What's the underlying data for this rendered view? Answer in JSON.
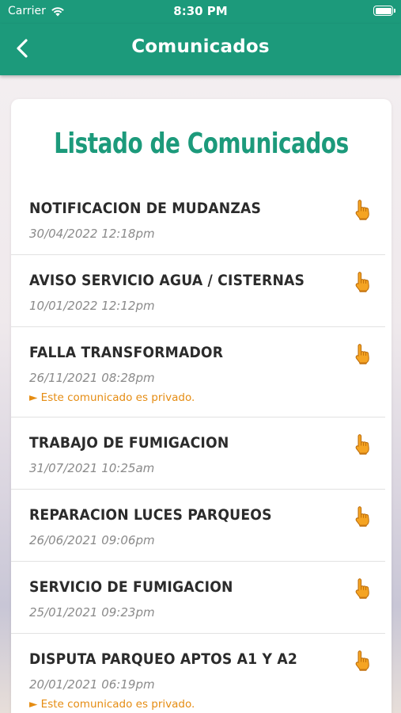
{
  "status": {
    "carrier": "Carrier",
    "time": "8:30 PM"
  },
  "nav": {
    "title": "Comunicados",
    "back_icon": "chevron-left-icon"
  },
  "list": {
    "heading": "Listado de Comunicados",
    "items": [
      {
        "title": "NOTIFICACION DE MUDANZAS",
        "date": "30/04/2022 12:18pm",
        "private": ""
      },
      {
        "title": "AVISO SERVICIO AGUA / CISTERNAS",
        "date": "10/01/2022 12:12pm",
        "private": ""
      },
      {
        "title": "FALLA TRANSFORMADOR",
        "date": "26/11/2021 08:28pm",
        "private": "► Este comunicado es privado."
      },
      {
        "title": "TRABAJO DE FUMIGACION",
        "date": "31/07/2021 10:25am",
        "private": ""
      },
      {
        "title": "REPARACION LUCES PARQUEOS",
        "date": "26/06/2021 09:06pm",
        "private": ""
      },
      {
        "title": "SERVICIO DE FUMIGACION",
        "date": "25/01/2021 09:23pm",
        "private": ""
      },
      {
        "title": "DISPUTA PARQUEO APTOS A1 Y A2",
        "date": "20/01/2021 06:19pm",
        "private": "► Este comunicado es privado."
      }
    ]
  },
  "colors": {
    "primary": "#1c9a7b",
    "accent": "#e58c12",
    "item_icon": "pointing-hand-icon"
  }
}
